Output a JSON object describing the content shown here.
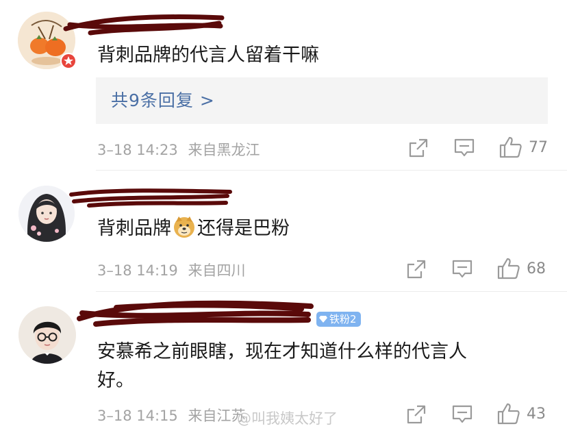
{
  "comments": [
    {
      "content": "背刺品牌的代言人留着干嘛",
      "reply_summary": "共9条回复 >",
      "date": "3–18 14:23",
      "location": "来自黑龙江",
      "likes": "77"
    },
    {
      "content_before_emoji": "背刺品牌",
      "emoji": "doge-emoji",
      "content_after_emoji": "还得是巴粉",
      "date": "3–18 14:19",
      "location": "来自四川",
      "likes": "68"
    },
    {
      "fan_badge": "铁粉2",
      "content_line1": "安慕希之前眼瞎，现在才知道什么样的代言人",
      "content_line2": "好。",
      "date": "3–18 14:15",
      "location": "来自江苏",
      "likes": "43"
    }
  ],
  "watermark": "@叫我姨太好了",
  "icons": [
    "share-icon",
    "comment-icon",
    "like-icon"
  ],
  "colors": {
    "text": "#1a1a1a",
    "meta": "#a3a3a3",
    "reply_link": "#4a6fa5",
    "reply_bg": "#f4f4f4",
    "redaction": "#5a0a0a",
    "fan_badge": "#7fb3f0"
  }
}
